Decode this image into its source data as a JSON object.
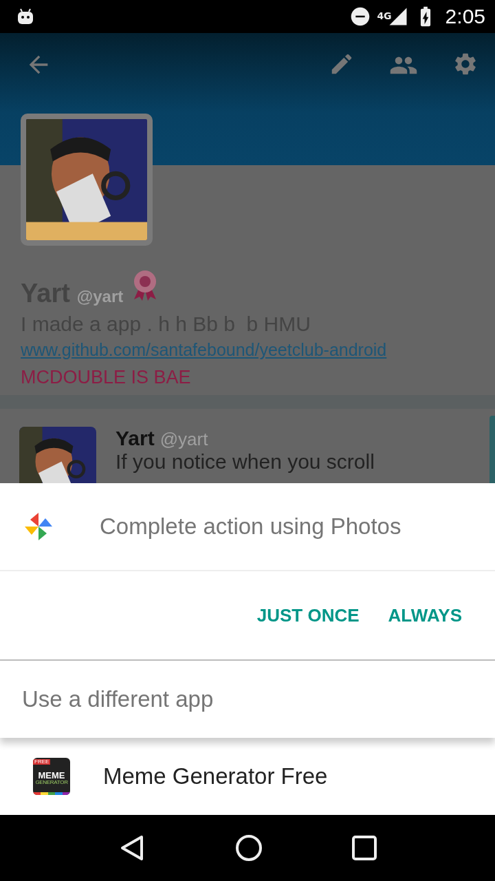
{
  "status_bar": {
    "network": "4G",
    "time": "2:05"
  },
  "profile": {
    "name": "Yart",
    "handle": "@yart",
    "bio": "I made a app . h h Bb b  b HMU",
    "link": "www.github.com/santafebound/yeetclub-android",
    "tagline": "MCDOUBLE IS BAE"
  },
  "post": {
    "name": "Yart",
    "handle": "@yart",
    "text": "If you notice when you scroll"
  },
  "dialog": {
    "title": "Complete action using Photos",
    "buttons": [
      "JUST ONCE",
      "ALWAYS"
    ],
    "other_label": "Use a different app"
  },
  "apps": [
    {
      "name": "Meme Generator Free",
      "icon_text": [
        "FREE",
        "MEME",
        "GENERATOR"
      ]
    }
  ]
}
